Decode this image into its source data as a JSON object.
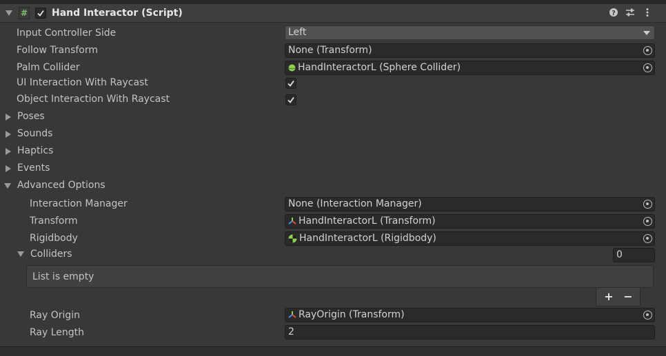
{
  "component": {
    "title": "Hand Interactor (Script)",
    "enabled": true
  },
  "fields": {
    "input_controller_side": {
      "label": "Input Controller Side",
      "value": "Left"
    },
    "follow_transform": {
      "label": "Follow Transform",
      "value": "None (Transform)"
    },
    "palm_collider": {
      "label": "Palm Collider",
      "value": "HandInteractorL (Sphere Collider)"
    },
    "ui_interaction": {
      "label": "UI Interaction With Raycast",
      "checked": true
    },
    "object_interaction": {
      "label": "Object Interaction With Raycast",
      "checked": true
    }
  },
  "foldouts": {
    "poses": "Poses",
    "sounds": "Sounds",
    "haptics": "Haptics",
    "events": "Events",
    "advanced": "Advanced Options"
  },
  "advanced": {
    "interaction_manager": {
      "label": "Interaction Manager",
      "value": "None (Interaction Manager)"
    },
    "transform": {
      "label": "Transform",
      "value": "HandInteractorL (Transform)"
    },
    "rigidbody": {
      "label": "Rigidbody",
      "value": "HandInteractorL (Rigidbody)"
    },
    "colliders": {
      "label": "Colliders",
      "count": "0",
      "empty_text": "List is empty",
      "add": "+",
      "remove": "−"
    },
    "ray_origin": {
      "label": "Ray Origin",
      "value": "RayOrigin (Transform)"
    },
    "ray_length": {
      "label": "Ray Length",
      "value": "2"
    }
  },
  "icons": {
    "help": "help-icon",
    "presets": "presets-icon",
    "menu": "kebab-menu-icon",
    "script": "script-hash-icon",
    "sphere_collider": "sphere-collider-icon",
    "transform": "transform-icon",
    "rigidbody": "rigidbody-icon"
  },
  "colors": {
    "background": "#383838",
    "field": "#2a2a2a",
    "text": "#c4c4c4",
    "script_icon": "#7ec06b",
    "collider_green": "#8fd14f"
  }
}
